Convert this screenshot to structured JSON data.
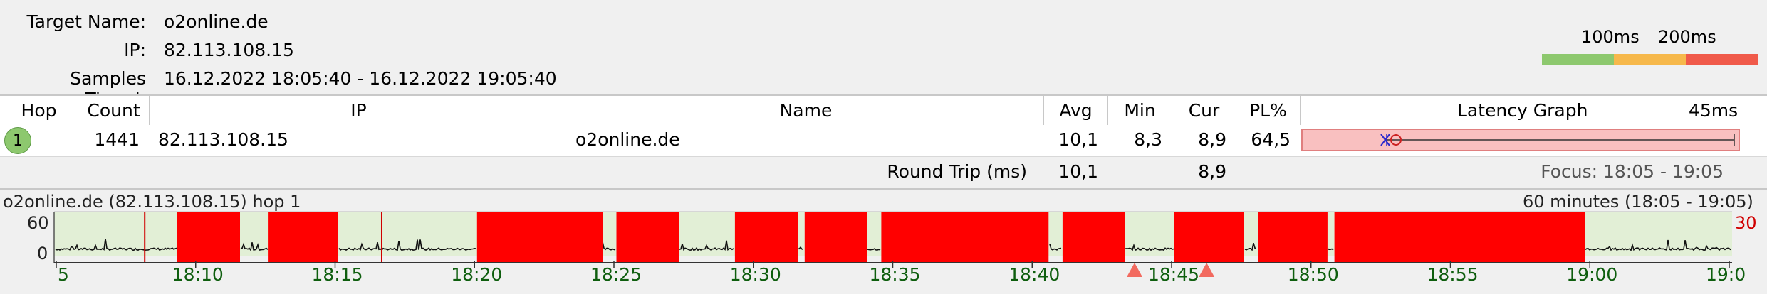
{
  "info": {
    "target_label": "Target Name:",
    "target_value": "o2online.de",
    "ip_label": "IP:",
    "ip_value": "82.113.108.15",
    "samples_label": "Samples Timed:",
    "samples_value": "16.12.2022 18:05:40 - 16.12.2022 19:05:40"
  },
  "legend": {
    "label_100": "100ms",
    "label_200": "200ms",
    "colors": {
      "good": "#8dc86e",
      "warn": "#f6b84b",
      "bad": "#f05a4a"
    }
  },
  "table": {
    "headers": {
      "hop": "Hop",
      "count": "Count",
      "ip": "IP",
      "name": "Name",
      "avg": "Avg",
      "min": "Min",
      "cur": "Cur",
      "pl": "PL%",
      "latency": "Latency Graph",
      "latency_max": "45ms"
    },
    "row": {
      "hop": "1",
      "count": "1441",
      "ip": "82.113.108.15",
      "name": "o2online.de",
      "avg": "10,1",
      "min": "8,3",
      "cur": "8,9",
      "pl": "64,5"
    },
    "round_trip": {
      "label": "Round Trip (ms)",
      "avg": "10,1",
      "cur": "8,9",
      "focus": "Focus: 18:05 - 19:05"
    }
  },
  "graph": {
    "title": "o2online.de (82.113.108.15) hop 1",
    "range_label": "60 minutes (18:05 - 19:05)",
    "y_top": "60",
    "y_bottom": "0",
    "y_right": "30",
    "x_labels": [
      "5",
      "18:10",
      "18:15",
      "18:20",
      "18:25",
      "18:30",
      "18:35",
      "18:40",
      "18:45",
      "18:50",
      "18:55",
      "19:00",
      "19:0"
    ]
  },
  "chart_data": {
    "type": "area",
    "title": "o2online.de (82.113.108.15) hop 1",
    "x_range": [
      "18:05",
      "19:05"
    ],
    "ylim": [
      0,
      60
    ],
    "packet_loss_periods": [
      [
        "18:09:15",
        "18:11:30"
      ],
      [
        "18:12:30",
        "18:15:00"
      ],
      [
        "18:20:00",
        "18:24:30"
      ],
      [
        "18:25:00",
        "18:27:15"
      ],
      [
        "18:29:15",
        "18:31:30"
      ],
      [
        "18:31:45",
        "18:34:00"
      ],
      [
        "18:34:30",
        "18:40:30"
      ],
      [
        "18:41:00",
        "18:43:15"
      ],
      [
        "18:45:00",
        "18:47:30"
      ],
      [
        "18:48:00",
        "18:50:30"
      ],
      [
        "18:50:45",
        "18:59:45"
      ]
    ],
    "loss_markers": [
      "18:08:05",
      "18:16:35"
    ],
    "alert_markers": [
      "18:43:35",
      "18:46:10"
    ],
    "latency_ms_typical": 9
  }
}
